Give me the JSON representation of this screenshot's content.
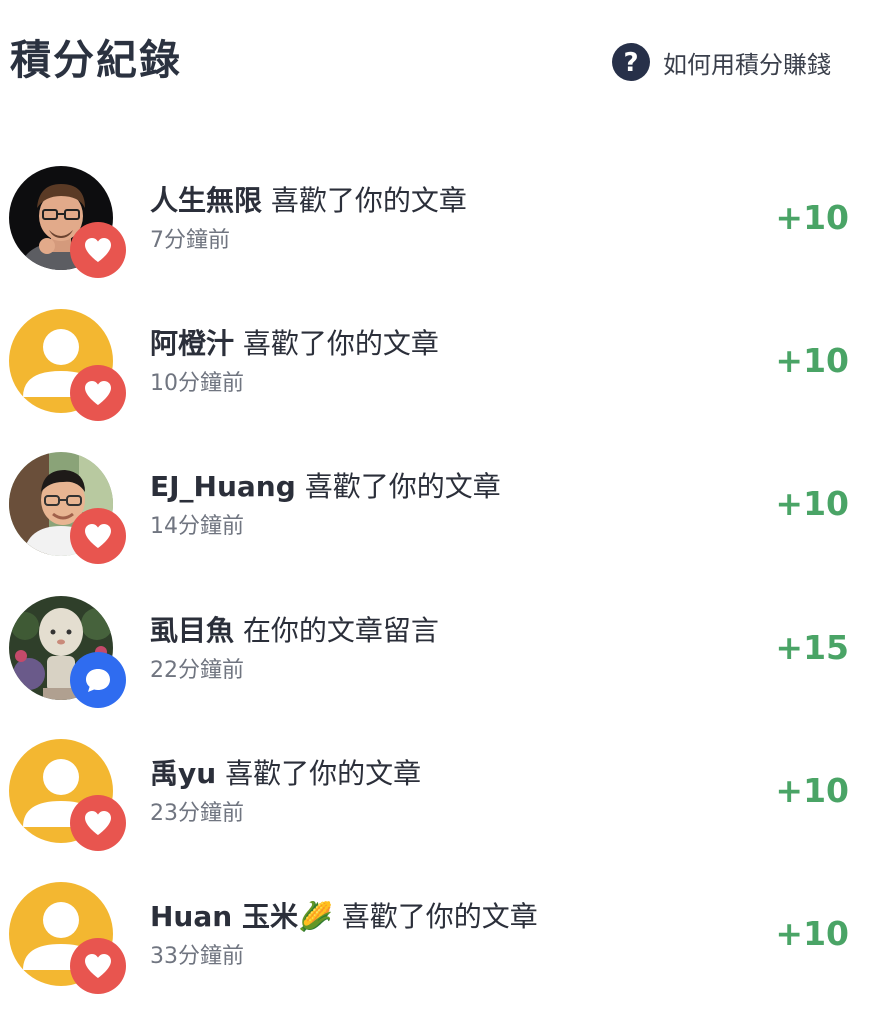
{
  "header": {
    "title": "積分紀錄",
    "help_icon": "question-circle-icon",
    "help_label": "如何用積分賺錢"
  },
  "colors": {
    "title": "#2b3240",
    "points_green": "#4aa466",
    "like_badge": "#e8554f",
    "comment_badge": "#2f6cf0",
    "default_avatar": "#f3b731",
    "muted_text": "#707580"
  },
  "records": [
    {
      "name": "人生無限",
      "action": "喜歡了你的文章",
      "time": "7分鐘前",
      "points": "+10",
      "avatar": "photo-avatar-man-with-glasses-icon",
      "badge": "heart-icon"
    },
    {
      "name": "阿橙汁",
      "action": "喜歡了你的文章",
      "time": "10分鐘前",
      "points": "+10",
      "avatar": "default-user-avatar-icon",
      "badge": "heart-icon"
    },
    {
      "name": "EJ_Huang",
      "action": "喜歡了你的文章",
      "time": "14分鐘前",
      "points": "+10",
      "avatar": "photo-avatar-man-in-garden-icon",
      "badge": "heart-icon"
    },
    {
      "name": "虱目魚",
      "action": "在你的文章留言",
      "time": "22分鐘前",
      "points": "+15",
      "avatar": "photo-avatar-statue-icon",
      "badge": "comment-bubble-icon"
    },
    {
      "name": "禹yu",
      "action": "喜歡了你的文章",
      "time": "23分鐘前",
      "points": "+10",
      "avatar": "default-user-avatar-icon",
      "badge": "heart-icon"
    },
    {
      "name": "Huan 玉米🌽",
      "action": "喜歡了你的文章",
      "time": "33分鐘前",
      "points": "+10",
      "avatar": "default-user-avatar-icon",
      "badge": "heart-icon"
    }
  ]
}
